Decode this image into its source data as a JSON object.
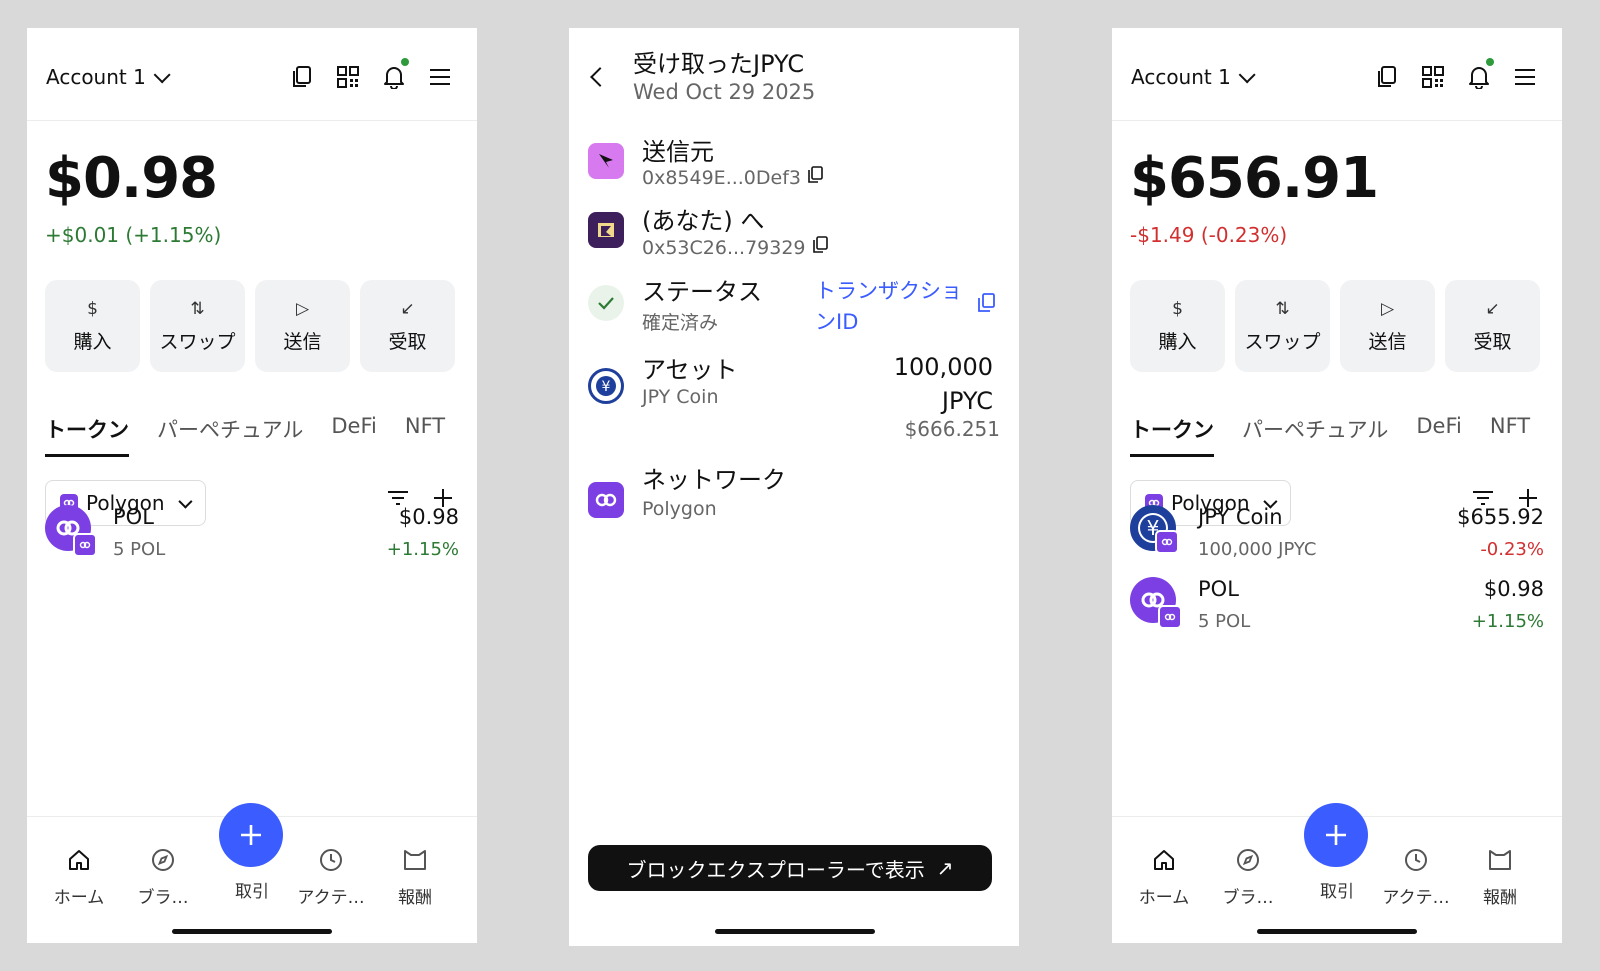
{
  "colors": {
    "accent": "#3b5cff",
    "positive": "#2d7a34",
    "negative": "#d23030",
    "polygon": "#7b3fe4",
    "jpyc": "#1f3f9c",
    "notification": "#2e9a3c"
  },
  "left": {
    "account_label": "Account 1",
    "balance": "$0.98",
    "delta": "+$0.01 (+1.15%)",
    "actions": [
      {
        "icon": "$",
        "label": "購入"
      },
      {
        "icon": "⇅",
        "label": "スワップ"
      },
      {
        "icon": "▷",
        "label": "送信"
      },
      {
        "icon": "↙",
        "label": "受取"
      }
    ],
    "tabs": [
      "トークン",
      "パーペチュアル",
      "DeFi",
      "NFT"
    ],
    "network": "Polygon",
    "tokens": [
      {
        "name": "POL",
        "amount": "5 POL",
        "value": "$0.98",
        "change": "+1.15%"
      }
    ],
    "nav": [
      "ホーム",
      "ブラ…",
      "取引",
      "アクテ…",
      "報酬"
    ]
  },
  "middle": {
    "title": "受け取ったJPYC",
    "date": "Wed Oct 29 2025",
    "from_label": "送信元",
    "from_address": "0x8549E...0Def3",
    "to_label": "(あなた) へ",
    "to_address": "0x53C26...79329",
    "status_label": "ステータス",
    "status_value": "確定済み",
    "tx_link_line1": "トランザクショ",
    "tx_link_line2": "ンID",
    "asset_label": "アセット",
    "asset_name": "JPY Coin",
    "asset_amount_line1": "100,000",
    "asset_amount_line2": "JPYC",
    "asset_fiat": "$666.251",
    "network_label": "ネットワーク",
    "network_value": "Polygon",
    "explorer_button": "ブロックエクスプローラーで表示",
    "explorer_arrow": "↗"
  },
  "right": {
    "account_label": "Account 1",
    "balance": "$656.91",
    "delta": "-$1.49 (-0.23%)",
    "actions": [
      {
        "icon": "$",
        "label": "購入"
      },
      {
        "icon": "⇅",
        "label": "スワップ"
      },
      {
        "icon": "▷",
        "label": "送信"
      },
      {
        "icon": "↙",
        "label": "受取"
      }
    ],
    "tabs": [
      "トークン",
      "パーペチュアル",
      "DeFi",
      "NFT"
    ],
    "network": "Polygon",
    "tokens": [
      {
        "name": "JPY Coin",
        "amount": "100,000 JPYC",
        "value": "$655.92",
        "change": "-0.23%"
      },
      {
        "name": "POL",
        "amount": "5 POL",
        "value": "$0.98",
        "change": "+1.15%"
      }
    ],
    "nav": [
      "ホーム",
      "ブラ…",
      "取引",
      "アクテ…",
      "報酬"
    ]
  }
}
